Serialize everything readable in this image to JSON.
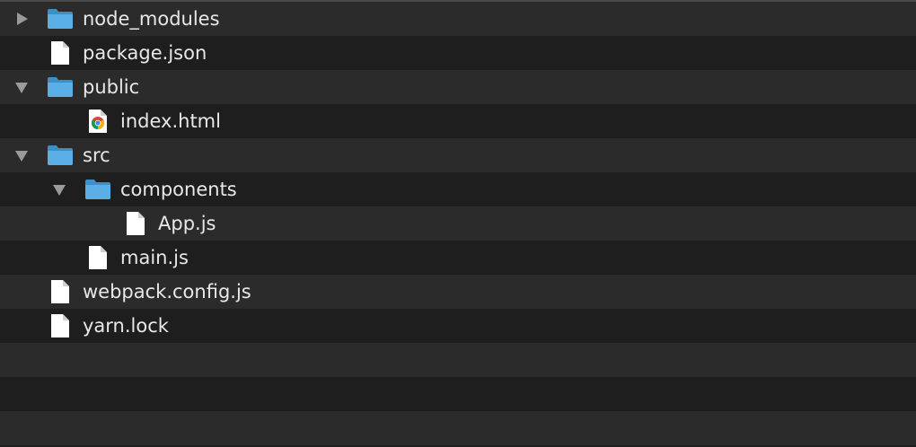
{
  "file_tree": {
    "items": [
      {
        "label": "node_modules",
        "kind": "folder",
        "state": "collapsed",
        "icon": "folder-icon",
        "depth": 0
      },
      {
        "label": "package.json",
        "kind": "file",
        "icon": "document-icon",
        "depth": 0
      },
      {
        "label": "public",
        "kind": "folder",
        "state": "expanded",
        "icon": "folder-icon",
        "depth": 0
      },
      {
        "label": "index.html",
        "kind": "file",
        "icon": "chrome-html-icon",
        "depth": 1
      },
      {
        "label": "src",
        "kind": "folder",
        "state": "expanded",
        "icon": "folder-icon",
        "depth": 0
      },
      {
        "label": "components",
        "kind": "folder",
        "state": "expanded",
        "icon": "folder-icon",
        "depth": 1
      },
      {
        "label": "App.js",
        "kind": "file",
        "icon": "document-icon",
        "depth": 2
      },
      {
        "label": "main.js",
        "kind": "file",
        "icon": "document-icon",
        "depth": 1
      },
      {
        "label": "webpack.config.js",
        "kind": "file",
        "icon": "document-icon",
        "depth": 0
      },
      {
        "label": "yarn.lock",
        "kind": "file",
        "icon": "document-icon",
        "depth": 0
      }
    ]
  },
  "colors": {
    "row_dark": "#1e1e1e",
    "row_light": "#2b2b2b",
    "text": "#e8e8e8",
    "folder": "#5ab0e6",
    "disclosure": "#9a9a9a"
  }
}
